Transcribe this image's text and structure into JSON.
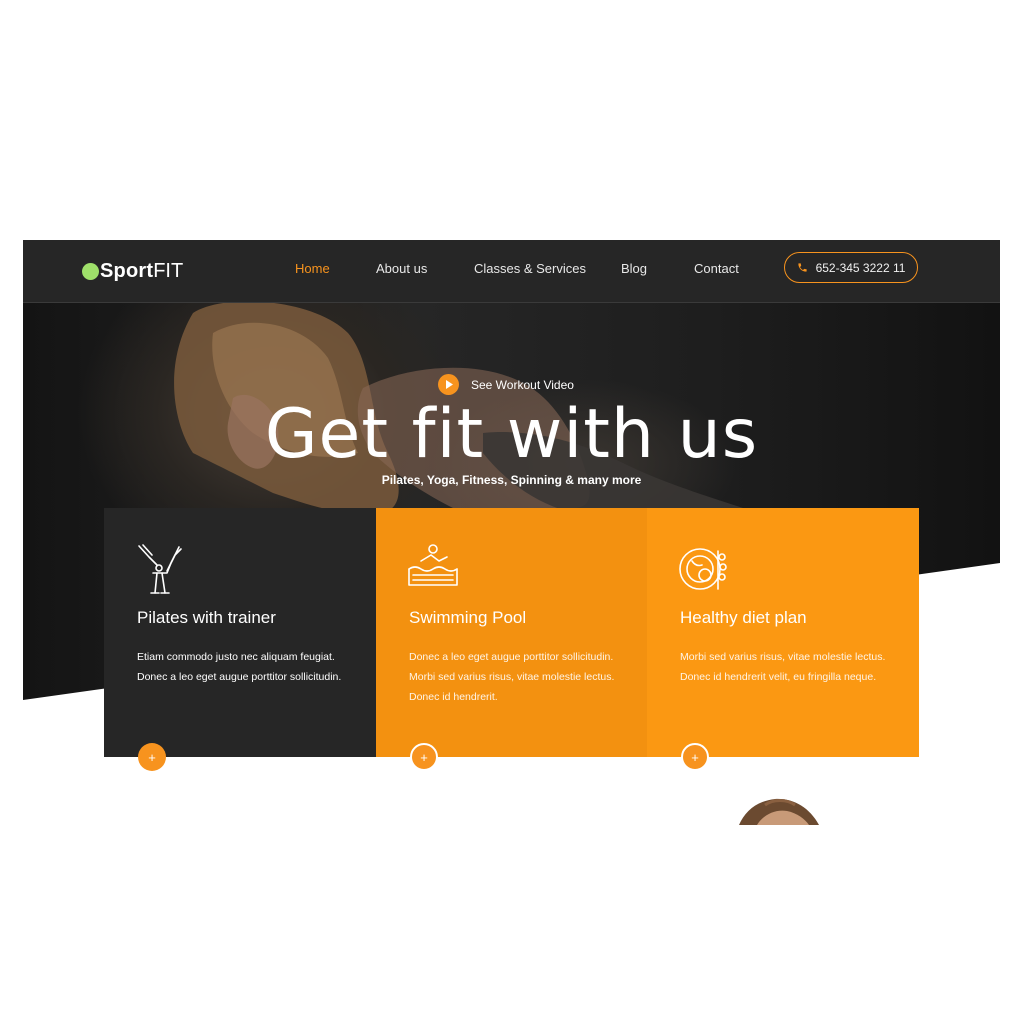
{
  "logo": {
    "sport": "Sport",
    "fit": "FIT"
  },
  "nav": {
    "items": [
      {
        "label": "Home",
        "active": true
      },
      {
        "label": "About us",
        "active": false
      },
      {
        "label": "Classes & Services",
        "active": false
      },
      {
        "label": "Blog",
        "active": false
      },
      {
        "label": "Contact",
        "active": false
      }
    ],
    "phone": "652-345 3222 11"
  },
  "hero": {
    "video_link": "See Workout Video",
    "title": "Get fit with us",
    "subtitle": "Pilates, Yoga, Fitness, Spinning & many more"
  },
  "cards": [
    {
      "title": "Pilates with trainer",
      "text": "Etiam commodo justo nec aliquam feugiat. Donec a leo eget augue porttitor sollicitudin.",
      "icon": "pilates-icon"
    },
    {
      "title": "Swimming Pool",
      "text": "Donec a leo eget augue porttitor sollicitudin. Morbi sed varius risus, vitae molestie lectus. Donec id hendrerit.",
      "icon": "swimming-icon"
    },
    {
      "title": "Healthy diet plan",
      "text": "Morbi sed varius risus, vitae molestie lectus. Donec id hendrerit velit, eu fringilla neque.",
      "icon": "diet-icon"
    }
  ],
  "colors": {
    "accent": "#f7931e",
    "dark": "#262626",
    "logo_dot": "#9fe06a"
  }
}
